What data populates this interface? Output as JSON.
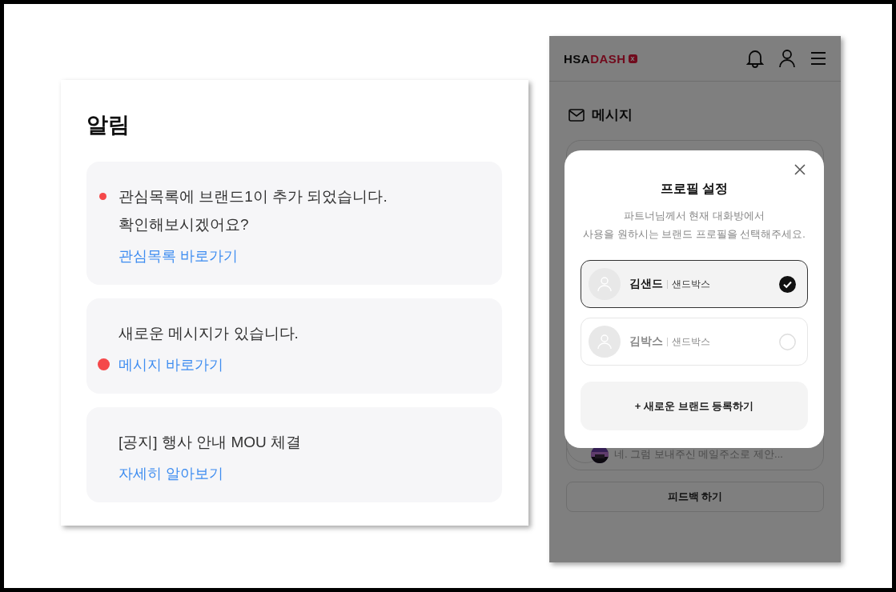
{
  "notifications_panel": {
    "title": "알림",
    "items": [
      {
        "lines": [
          "관심목록에 브랜드1이 추가 되었습니다.",
          "확인해보시겠어요?"
        ],
        "link": "관심목록 바로가기",
        "title_dot": true,
        "link_dot": false
      },
      {
        "lines": [
          "새로운 메시지가 있습니다."
        ],
        "link": "메시지 바로가기",
        "title_dot": false,
        "link_dot": true
      },
      {
        "lines": [
          "[공지] 행사 안내 MOU 체결"
        ],
        "link": "자세히 알아보기",
        "title_dot": false,
        "link_dot": false
      }
    ]
  },
  "mobile": {
    "logo": {
      "dark": "HSA",
      "accent": "DASH",
      "badge": "x"
    },
    "section_title": "메시지",
    "message_preview": "네. 그럼 보내주신 메일주소로 제안...",
    "feedback_button": "피드백 하기",
    "modal": {
      "title": "프로필 설정",
      "description": [
        "파트너님께서 현재 대화방에서",
        "사용을 원하시는 브랜드 프로필을 선택해주세요."
      ],
      "profiles": [
        {
          "name": "김샌드",
          "brand": "샌드박스",
          "selected": true
        },
        {
          "name": "김박스",
          "brand": "샌드박스",
          "selected": false
        }
      ],
      "add_button": "+ 새로운 브랜드 등록하기"
    }
  }
}
